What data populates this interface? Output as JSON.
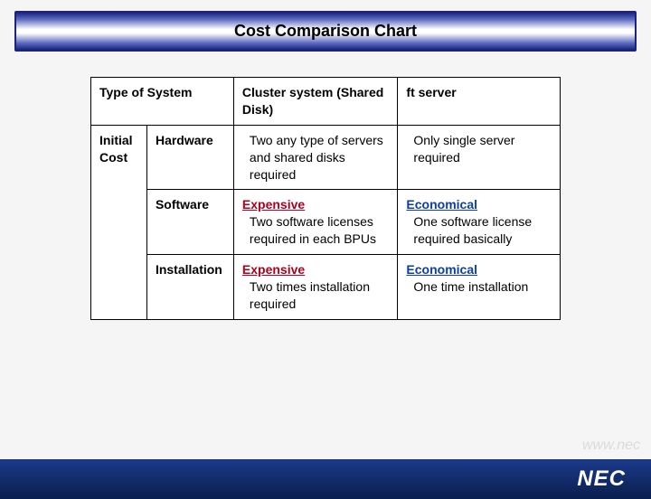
{
  "title": "Cost Comparison Chart",
  "table": {
    "header": {
      "type_of_system": "Type of System",
      "col_a": "Cluster system (Shared Disk)",
      "col_b": "ft server"
    },
    "row_label": "Initial Cost",
    "rows": [
      {
        "sub": "Hardware",
        "a_emph": "",
        "a_detail": "Two any type of servers and shared disks required",
        "b_emph": "",
        "b_detail": "Only single server required"
      },
      {
        "sub": "Software",
        "a_emph": "Expensive",
        "a_detail": "Two software licenses  required in each  BPUs",
        "b_emph": "Economical",
        "b_detail": "One software license  required basically"
      },
      {
        "sub": "Installation",
        "a_emph": "Expensive",
        "a_detail": "Two times installation required",
        "b_emph": "Economical",
        "b_detail": "One time installation"
      }
    ]
  },
  "footer": {
    "logo": "NEC",
    "bg_text": "www.nec"
  },
  "chart_data": {
    "type": "table",
    "title": "Cost Comparison Chart",
    "columns": [
      "Type of System",
      "Cluster system (Shared Disk)",
      "ft server"
    ],
    "row_group": "Initial Cost",
    "rows": [
      {
        "category": "Hardware",
        "cluster_system": "Two any type of servers and shared disks required",
        "ft_server": "Only single server required"
      },
      {
        "category": "Software",
        "cluster_system": "Expensive — Two software licenses required in each BPUs",
        "ft_server": "Economical — One software license required basically"
      },
      {
        "category": "Installation",
        "cluster_system": "Expensive — Two times installation required",
        "ft_server": "Economical — One time installation"
      }
    ]
  }
}
